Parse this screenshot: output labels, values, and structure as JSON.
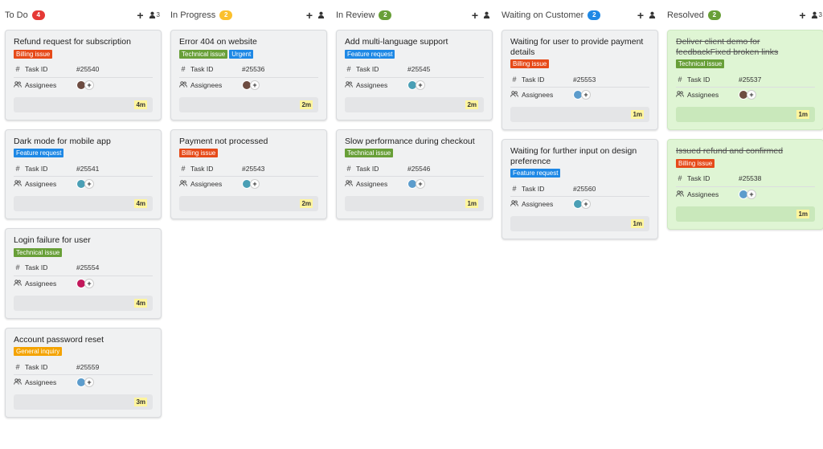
{
  "tag_colors": {
    "Billing issue": "#e64a19",
    "Technical issue": "#689f38",
    "Feature request": "#1e88e5",
    "Urgent": "#1e88e5",
    "General inquiry": "#f4a300"
  },
  "labels": {
    "task_id": "Task ID",
    "assignees": "Assignees"
  },
  "columns": [
    {
      "name": "To Do",
      "count": "4",
      "count_color": "#e53935",
      "member_count": "3",
      "cards": [
        {
          "title": "Refund request for subscription",
          "tags": [
            "Billing issue"
          ],
          "task_id": "#25540",
          "avatar": "#6d4c41",
          "time": "4m"
        },
        {
          "title": "Dark mode for mobile app",
          "tags": [
            "Feature request"
          ],
          "task_id": "#25541",
          "avatar": "#4a9fb5",
          "time": "4m"
        },
        {
          "title": "Login failure for user",
          "tags": [
            "Technical issue"
          ],
          "task_id": "#25554",
          "avatar": "#c2185b",
          "time": "4m"
        },
        {
          "title": "Account password reset",
          "tags": [
            "General inquiry"
          ],
          "task_id": "#25559",
          "avatar": "#5c9ccc",
          "time": "3m"
        }
      ]
    },
    {
      "name": "In Progress",
      "count": "2",
      "count_color": "#fbc02d",
      "member_count": "",
      "cards": [
        {
          "title": "Error 404 on website",
          "tags": [
            "Technical issue",
            "Urgent"
          ],
          "task_id": "#25536",
          "avatar": "#6d4c41",
          "time": "2m"
        },
        {
          "title": "Payment not processed",
          "tags": [
            "Billing issue"
          ],
          "task_id": "#25543",
          "avatar": "#4a9fb5",
          "time": "2m"
        }
      ]
    },
    {
      "name": "In Review",
      "count": "2",
      "count_color": "#689f38",
      "member_count": "",
      "cards": [
        {
          "title": "Add multi-language support",
          "tags": [
            "Feature request"
          ],
          "task_id": "#25545",
          "avatar": "#4a9fb5",
          "time": "2m"
        },
        {
          "title": "Slow performance during checkout",
          "tags": [
            "Technical issue"
          ],
          "task_id": "#25546",
          "avatar": "#5c9ccc",
          "time": "1m"
        }
      ]
    },
    {
      "name": "Waiting on Customer",
      "count": "2",
      "count_color": "#1e88e5",
      "member_count": "",
      "cards": [
        {
          "title": "Waiting for user to provide payment details",
          "tags": [
            "Billing issue"
          ],
          "task_id": "#25553",
          "avatar": "#5c9ccc",
          "time": "1m"
        },
        {
          "title": "Waiting for further input on design preference",
          "tags": [
            "Feature request"
          ],
          "task_id": "#25560",
          "avatar": "#4a9fb5",
          "time": "1m"
        }
      ]
    },
    {
      "name": "Resolved",
      "count": "2",
      "count_color": "#689f38",
      "member_count": "3",
      "resolved": true,
      "cards": [
        {
          "title": "Deliver client demo for feedbackFixed broken links",
          "tags": [
            "Technical issue"
          ],
          "task_id": "#25537",
          "avatar": "#6d4c41",
          "time": "1m"
        },
        {
          "title": "Issued refund and confirmed",
          "tags": [
            "Billing issue"
          ],
          "task_id": "#25538",
          "avatar": "#5c9ccc",
          "time": "1m"
        }
      ]
    }
  ]
}
